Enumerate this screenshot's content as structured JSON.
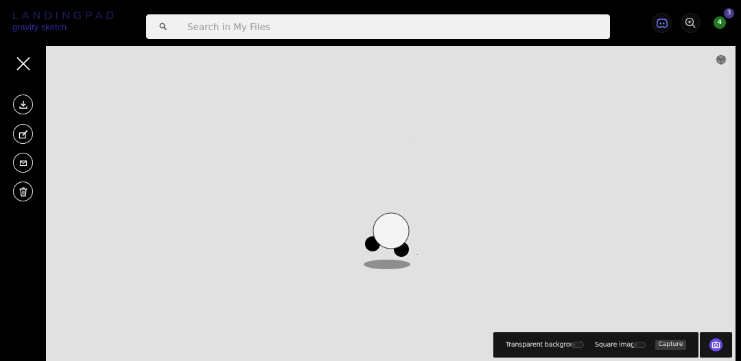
{
  "header": {
    "logo_title": "LANDINGPAD",
    "logo_subtitle": "gravity sketch",
    "search": {
      "placeholder": "Search in My Files",
      "icon": "search-icon"
    },
    "discord_icon": "discord-icon",
    "zoom_icon": "zoom-in-icon",
    "avatar_label": "4",
    "notification_count": "3"
  },
  "sidebar": {
    "close_icon": "close-icon",
    "actions": [
      {
        "name": "download",
        "icon": "download-icon"
      },
      {
        "name": "edit",
        "icon": "edit-icon"
      },
      {
        "name": "share",
        "icon": "mail-icon"
      },
      {
        "name": "delete",
        "icon": "trash-icon"
      }
    ]
  },
  "viewer": {
    "background": "#e1e1e1",
    "view_cube_icon": "view-cube-icon"
  },
  "capture": {
    "transparent_label": "Transparent background",
    "transparent_on": false,
    "square_label": "Square image",
    "square_on": false,
    "capture_label": "Capture",
    "camera_icon": "camera-icon",
    "accent": "#6a4cf0"
  },
  "colors": {
    "logo": "#1d1f66",
    "avatar": "#1e7a1e",
    "badge": "#4a3a8a"
  }
}
